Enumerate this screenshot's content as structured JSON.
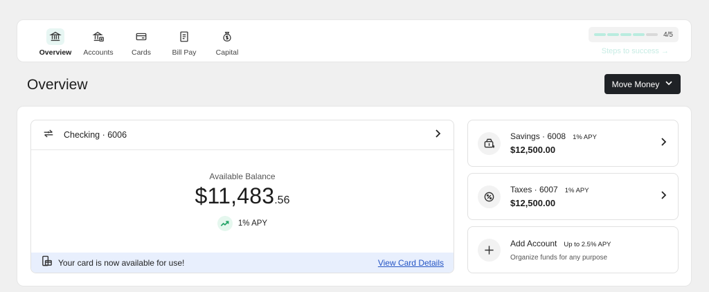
{
  "nav": {
    "items": [
      {
        "label": "Overview",
        "icon": "bank-icon",
        "active": true
      },
      {
        "label": "Accounts",
        "icon": "accounts-icon",
        "active": false
      },
      {
        "label": "Cards",
        "icon": "card-icon",
        "active": false
      },
      {
        "label": "Bill Pay",
        "icon": "bill-icon",
        "active": false
      },
      {
        "label": "Capital",
        "icon": "money-bag-icon",
        "active": false
      }
    ]
  },
  "progress": {
    "count": "4/5",
    "completed_fraction": 0.8,
    "steps_link": "Steps to success →"
  },
  "header": {
    "title": "Overview",
    "move_money_label": "Move Money"
  },
  "checking": {
    "name": "Checking · 6006",
    "balance_label": "Available Balance",
    "balance_whole": "$11,483",
    "balance_cents": ".56",
    "apy": "1% APY",
    "banner_text": "Your card is now available for use!",
    "banner_link": "View Card Details"
  },
  "side_accounts": [
    {
      "name": "Savings · 6008",
      "badge": "1% APY",
      "amount": "$12,500.00",
      "icon": "savings-icon"
    },
    {
      "name": "Taxes · 6007",
      "badge": "1% APY",
      "amount": "$12,500.00",
      "icon": "percent-icon"
    }
  ],
  "add_account": {
    "name": "Add Account",
    "badge": "Up to 2.5% APY",
    "subtitle": "Organize funds for any purpose",
    "icon": "plus-icon"
  },
  "colors": {
    "accent": "#b9ecdf",
    "dark_button": "#1f2226",
    "banner_bg": "#e8effd",
    "link": "#2454c4",
    "apy_green": "#21a366"
  }
}
